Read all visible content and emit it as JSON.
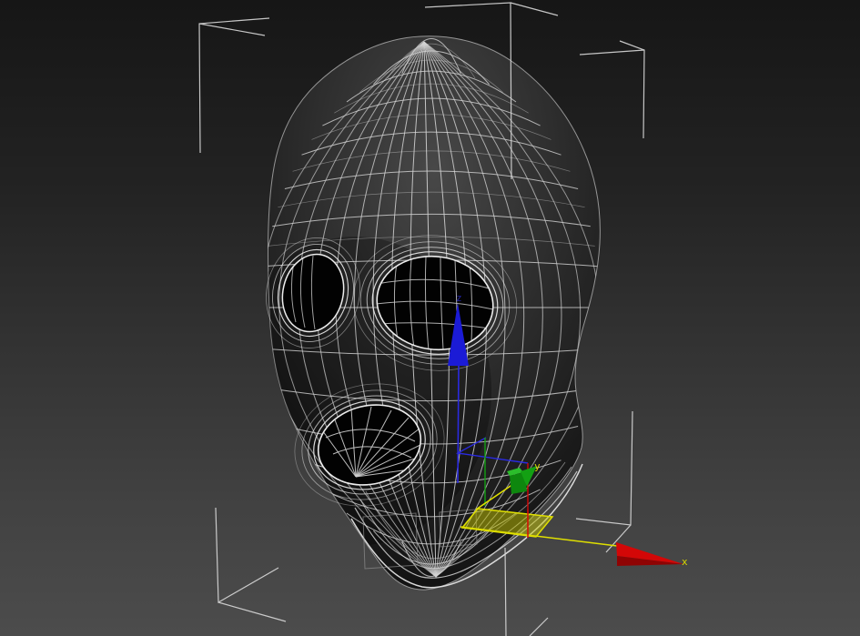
{
  "viewport": {
    "kind": "perspective-3d-viewport",
    "background_top_color": "#161616",
    "background_bottom_color": "#4c4c4c",
    "wireframe_color": "#d4d4d4",
    "surface_color": "#1a1a1a",
    "selection_bracket_color": "#d9d9d9",
    "grid_cell_outline_color": "#9a9a9a"
  },
  "object": {
    "name": "balaclava-head-mesh",
    "display_mode": "wireframe-on-shaded",
    "holes": [
      "left-eye",
      "right-eye",
      "mouth"
    ]
  },
  "gizmo": {
    "type": "move-transform-gizmo",
    "labels": {
      "x": "x",
      "y": "y",
      "z": "z"
    },
    "colors": {
      "x_axis": "#d30707",
      "x_axis_dark": "#8f0303",
      "y_axis": "#13a013",
      "y_axis_light": "#2bbd2b",
      "y_axis_dark": "#0e870e",
      "z_axis": "#1b1bd6",
      "highlight": "#e0e000",
      "plane_fill": "#c8c800",
      "label_x": "#d8d800",
      "label_y": "#d8d800",
      "label_z": "#2424a8"
    },
    "active_handle": "xy-plane"
  }
}
